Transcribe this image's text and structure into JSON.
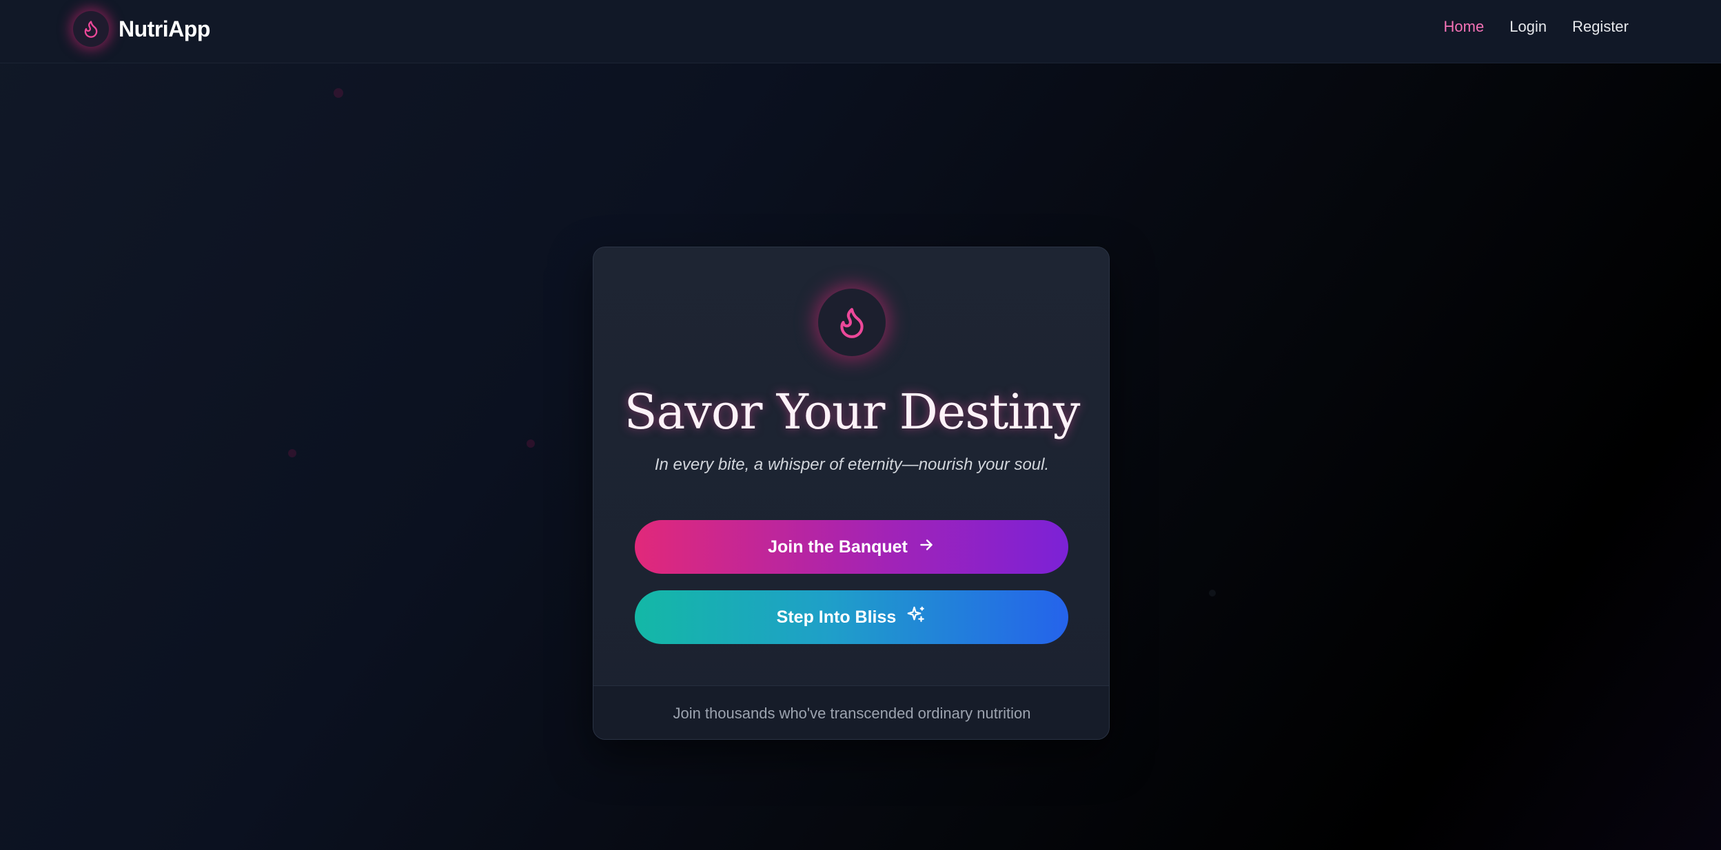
{
  "nav": {
    "brand": "NutriApp",
    "brand_icon": "flame-icon",
    "links": [
      {
        "label": "Home",
        "active": true
      },
      {
        "label": "Login",
        "active": false
      },
      {
        "label": "Register",
        "active": false
      }
    ]
  },
  "hero": {
    "icon": "flame-icon",
    "title": "Savor Your Destiny",
    "subtitle": "In every bite, a whisper of eternity—nourish your soul.",
    "primary_button": {
      "label": "Join the Banquet",
      "icon": "arrow-right-icon"
    },
    "secondary_button": {
      "label": "Step Into Bliss",
      "icon": "sparkle-icon"
    },
    "footer_text": "Join thousands who've transcended ordinary nutrition"
  },
  "colors": {
    "accent_pink": "#ec4899",
    "active_link": "#f472b6",
    "primary_gradient": [
      "#e1297a",
      "#7c22d6"
    ],
    "secondary_gradient": [
      "#14b8a6",
      "#2563eb"
    ],
    "background": "#0b1120"
  }
}
